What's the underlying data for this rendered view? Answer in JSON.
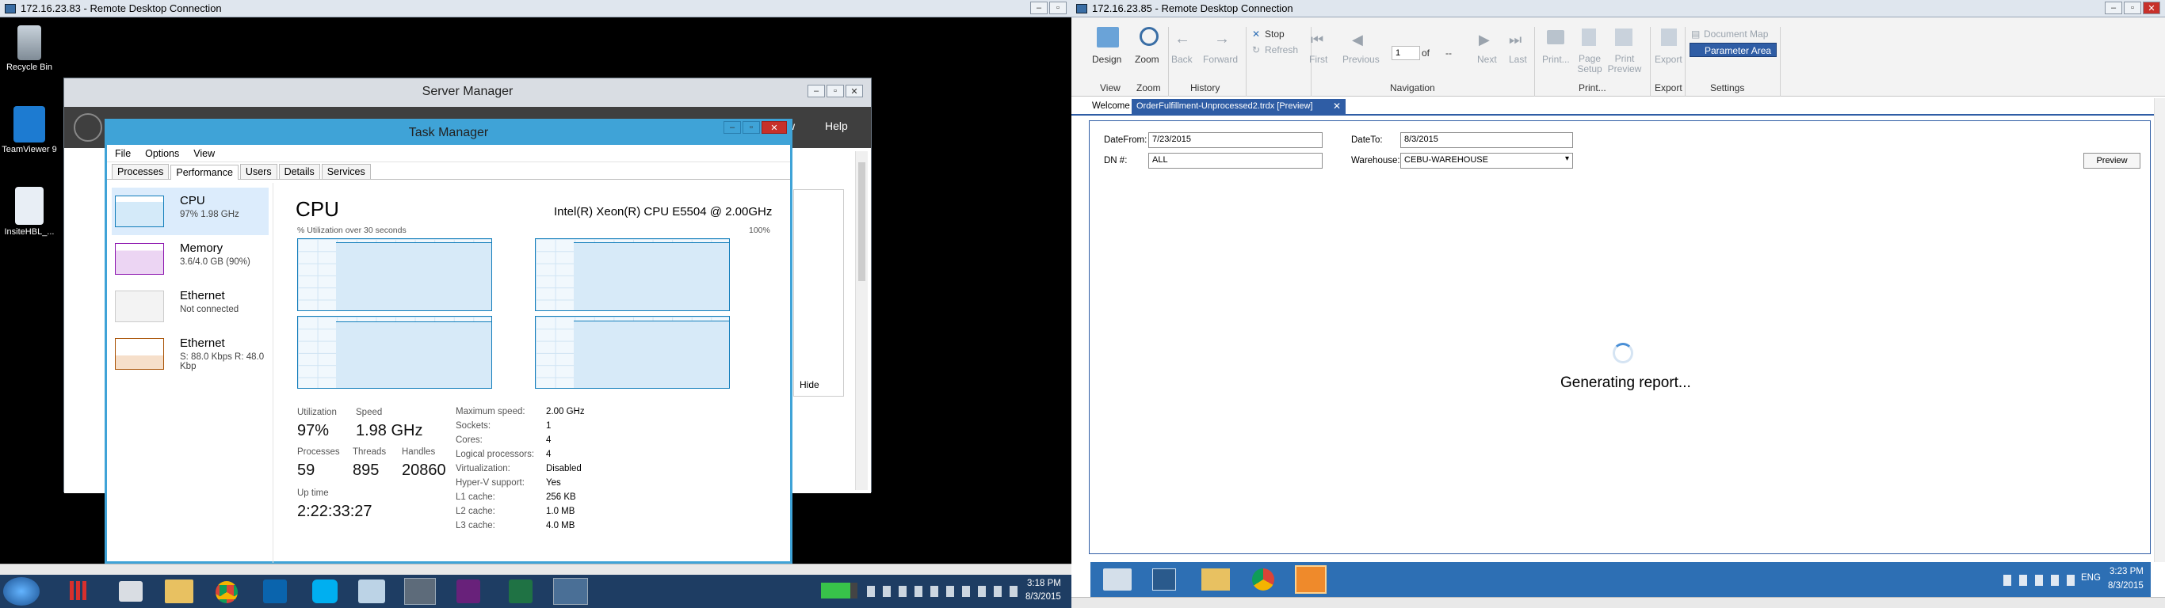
{
  "left_session": {
    "title": "172.16.23.83 - Remote Desktop Connection",
    "desktop_icons": [
      "Recycle Bin",
      "TeamViewer 9",
      "InsiteHBL_..."
    ],
    "server_manager": {
      "title": "Server Manager",
      "help": "Help",
      "partial_w": "w",
      "hide": "Hide"
    },
    "task_manager": {
      "title": "Task Manager",
      "menu": [
        "File",
        "Options",
        "View"
      ],
      "tabs": [
        "Processes",
        "Performance",
        "Users",
        "Details",
        "Services"
      ],
      "side": [
        {
          "name": "CPU",
          "detail": "97% 1.98 GHz"
        },
        {
          "name": "Memory",
          "detail": "3.6/4.0 GB (90%)"
        },
        {
          "name": "Ethernet",
          "detail": "Not connected"
        },
        {
          "name": "Ethernet",
          "detail": "S: 88.0 Kbps R: 48.0 Kbp"
        }
      ],
      "heading": "CPU",
      "cpu_model": "Intel(R) Xeon(R) CPU E5504 @ 2.00GHz",
      "graph_label": "% Utilization over 30 seconds",
      "graph_max": "100%",
      "stats": {
        "utilization_label": "Utilization",
        "utilization": "97%",
        "speed_label": "Speed",
        "speed": "1.98 GHz",
        "processes_label": "Processes",
        "processes": "59",
        "threads_label": "Threads",
        "threads": "895",
        "handles_label": "Handles",
        "handles": "20860",
        "uptime_label": "Up time",
        "uptime": "2:22:33:27"
      },
      "specs": [
        [
          "Maximum speed:",
          "2.00 GHz"
        ],
        [
          "Sockets:",
          "1"
        ],
        [
          "Cores:",
          "4"
        ],
        [
          "Logical processors:",
          "4"
        ],
        [
          "Virtualization:",
          "Disabled"
        ],
        [
          "Hyper-V support:",
          "Yes"
        ],
        [
          "L1 cache:",
          "256 KB"
        ],
        [
          "L2 cache:",
          "1.0 MB"
        ],
        [
          "L3 cache:",
          "4.0 MB"
        ]
      ]
    },
    "clock": {
      "time": "3:18 PM",
      "date": "8/3/2015"
    }
  },
  "right_session": {
    "title": "172.16.23.85 - Remote Desktop Connection",
    "ribbon": {
      "design": "Design",
      "zoom": "Zoom",
      "back": "Back",
      "forward": "Forward",
      "stop": "Stop",
      "refresh": "Refresh",
      "first": "First",
      "previous": "Previous",
      "page": "1",
      "of": "of",
      "total": "--",
      "next": "Next",
      "last": "Last",
      "print": "Print...",
      "page_setup": "Page Setup",
      "print_preview": "Print Preview",
      "export": "Export",
      "document_map": "Document Map",
      "parameter_area": "Parameter Area",
      "groups": [
        "View",
        "Zoom",
        "History",
        "Navigation",
        "Print...",
        "Export",
        "Settings"
      ]
    },
    "tabs": {
      "welcome": "Welcome",
      "doc": "OrderFulfillment-Unprocessed2.trdx [Preview]"
    },
    "params": {
      "datefrom_label": "DateFrom:",
      "datefrom": "7/23/2015",
      "dateto_label": "DateTo:",
      "dateto": "8/3/2015",
      "dn_label": "DN #:",
      "dn": "ALL",
      "warehouse_label": "Warehouse:",
      "warehouse": "CEBU-WAREHOUSE",
      "preview": "Preview"
    },
    "status": "Generating report...",
    "tray": {
      "lang": "ENG",
      "time": "3:23 PM",
      "date": "8/3/2015"
    }
  }
}
